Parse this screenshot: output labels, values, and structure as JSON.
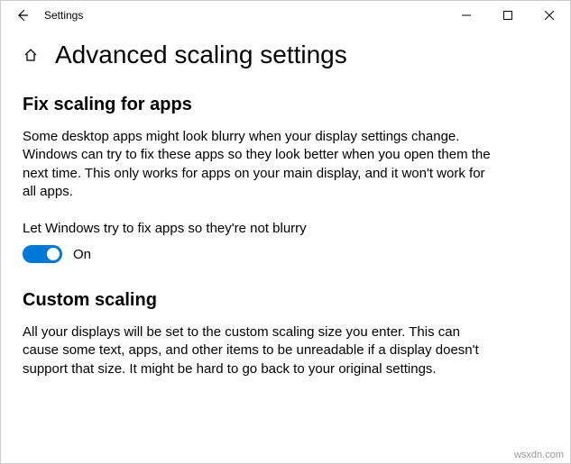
{
  "window": {
    "title": "Settings"
  },
  "page": {
    "title": "Advanced scaling settings"
  },
  "sections": {
    "fix_scaling": {
      "heading": "Fix scaling for apps",
      "description": "Some desktop apps might look blurry when your display settings change. Windows can try to fix these apps so they look better when you open them the next time. This only works for apps on your main display, and it won't work for all apps.",
      "toggle_label": "Let Windows try to fix apps so they're not blurry",
      "toggle_state": "On"
    },
    "custom_scaling": {
      "heading": "Custom scaling",
      "description": "All your displays will be set to the custom scaling size you enter. This can cause some text, apps, and other items to be unreadable if a display doesn't support that size. It might be hard to go back to your original settings."
    }
  },
  "watermark": "wsxdn.com"
}
